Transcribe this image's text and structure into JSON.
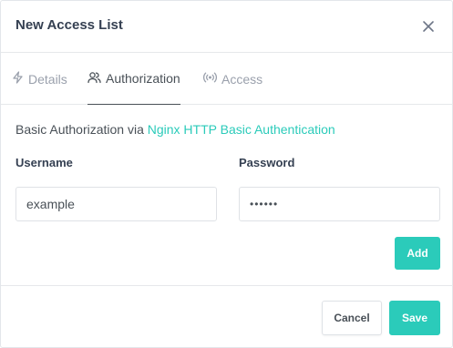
{
  "modal": {
    "title": "New Access List",
    "close_icon": "close-icon"
  },
  "tabs": [
    {
      "label": "Details",
      "icon": "lightning-icon",
      "active": false
    },
    {
      "label": "Authorization",
      "icon": "users-icon",
      "active": true
    },
    {
      "label": "Access",
      "icon": "broadcast-icon",
      "active": false
    }
  ],
  "authorization": {
    "description_prefix": "Basic Authorization via ",
    "description_link": "Nginx HTTP Basic Authentication",
    "username_label": "Username",
    "password_label": "Password",
    "username_value": "example",
    "password_value": "••••••",
    "add_label": "Add"
  },
  "footer": {
    "cancel_label": "Cancel",
    "save_label": "Save"
  },
  "colors": {
    "accent": "#2bcbba",
    "text": "#354052",
    "muted": "#9aa0ac"
  }
}
